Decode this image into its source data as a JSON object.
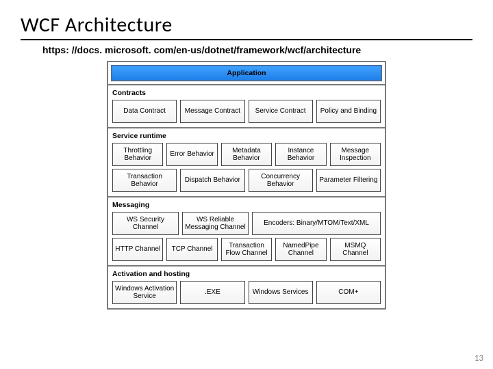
{
  "slide": {
    "title": "WCF Architecture",
    "link": "https: //docs. microsoft. com/en-us/dotnet/framework/wcf/architecture",
    "page_number": "13"
  },
  "diagram": {
    "app_header": "Application",
    "layers": [
      {
        "title": "Contracts",
        "rows": [
          [
            "Data Contract",
            "Message Contract",
            "Service Contract",
            "Policy and Binding"
          ]
        ]
      },
      {
        "title": "Service runtime",
        "rows": [
          [
            "Throttling Behavior",
            "Error Behavior",
            "Metadata Behavior",
            "Instance Behavior",
            "Message Inspection"
          ],
          [
            "Transaction Behavior",
            "Dispatch Behavior",
            "Concurrency Behavior",
            "Parameter Filtering"
          ]
        ]
      },
      {
        "title": "Messaging",
        "rows": [
          [
            "WS Security Channel",
            "WS Reliable Messaging Channel",
            "Encoders: Binary/MTOM/Text/XML"
          ],
          [
            "HTTP Channel",
            "TCP Channel",
            "Transaction Flow Channel",
            "NamedPipe Channel",
            "MSMQ Channel"
          ]
        ]
      },
      {
        "title": "Activation and hosting",
        "rows": [
          [
            "Windows Activation Service",
            ".EXE",
            "Windows Services",
            "COM+"
          ]
        ]
      }
    ]
  }
}
